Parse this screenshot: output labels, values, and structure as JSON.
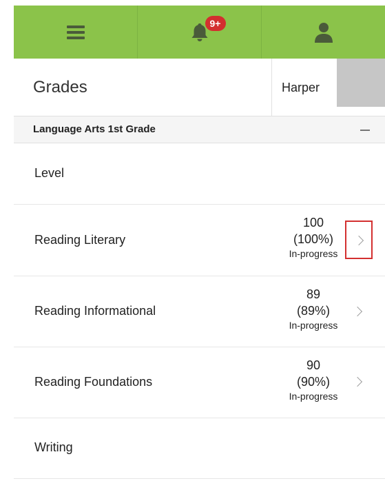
{
  "header": {
    "menu_icon": "hamburger-menu-icon",
    "notification_badge": "9+",
    "notification_icon": "bell-icon",
    "profile_icon": "person-icon",
    "brand_color": "#8bc34a",
    "badge_color": "#d32f2f"
  },
  "page": {
    "title": "Grades",
    "student_name": "Harper"
  },
  "course": {
    "title": "Language Arts 1st Grade",
    "collapse_icon": "minus-icon",
    "rows": [
      {
        "label": "Level"
      },
      {
        "label": "Reading Literary",
        "score": "100",
        "percent": "(100%)",
        "status": "In-progress"
      },
      {
        "label": "Reading Informational",
        "score": "89",
        "percent": "(89%)",
        "status": "In-progress"
      },
      {
        "label": "Reading Foundations",
        "score": "90",
        "percent": "(90%)",
        "status": "In-progress"
      },
      {
        "label": "Writing"
      }
    ]
  }
}
